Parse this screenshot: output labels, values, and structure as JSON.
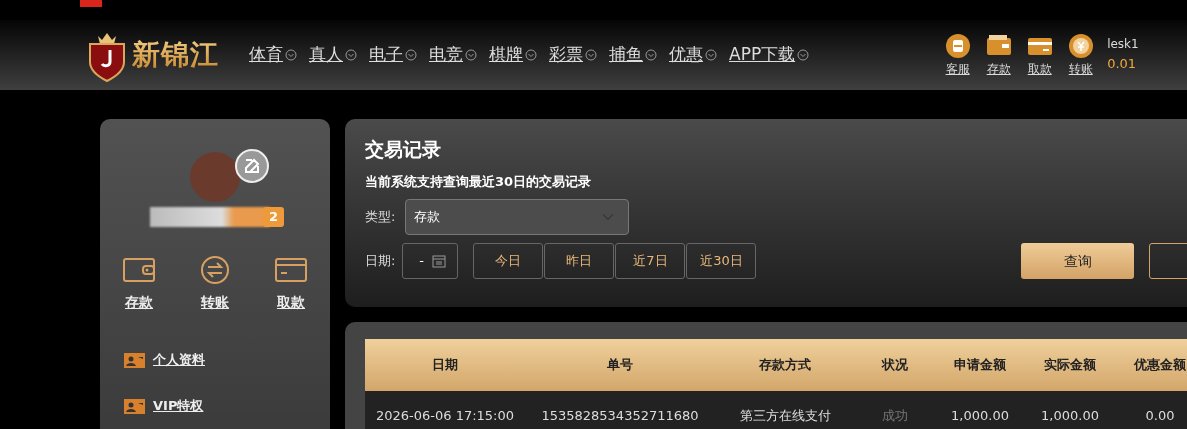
{
  "header": {
    "logo_text": "新锦江",
    "nav": [
      {
        "label": "体育"
      },
      {
        "label": "真人"
      },
      {
        "label": "电子"
      },
      {
        "label": "电竞"
      },
      {
        "label": "棋牌"
      },
      {
        "label": "彩票"
      },
      {
        "label": "捕鱼"
      },
      {
        "label": "优惠"
      },
      {
        "label": "APP下载"
      }
    ],
    "actions": [
      {
        "kind": "service",
        "label": "客服"
      },
      {
        "kind": "wallet",
        "label": "存款"
      },
      {
        "kind": "card",
        "label": "取款"
      },
      {
        "kind": "coin",
        "label": "转账"
      }
    ],
    "user": {
      "name": "lesk1",
      "balance": "0.01"
    }
  },
  "sidebar": {
    "vip_level": "2",
    "quick": [
      {
        "kind": "wallet",
        "label": "存款"
      },
      {
        "kind": "transfer",
        "label": "转账"
      },
      {
        "kind": "card",
        "label": "取款"
      }
    ],
    "menu": [
      {
        "label": "个人资料"
      },
      {
        "label": "VIP特权"
      }
    ]
  },
  "main": {
    "title": "交易记录",
    "note": "当前系统支持查询最近30日的交易记录",
    "type_label": "类型:",
    "type_value": "存款",
    "date_label": "日期:",
    "date_value": "-",
    "ranges": [
      {
        "label": "今日"
      },
      {
        "label": "昨日"
      },
      {
        "label": "近7日"
      },
      {
        "label": "近30日"
      }
    ],
    "query_button": "查询"
  },
  "table": {
    "columns": [
      "日期",
      "单号",
      "存款方式",
      "状况",
      "申请金额",
      "实际金额",
      "优惠金额"
    ],
    "rows": [
      [
        "2026-06-06 17:15:00",
        "1535828534352711680",
        "第三方在线支付",
        "成功",
        "1,000.00",
        "1,000.00",
        "0.00"
      ]
    ]
  }
}
